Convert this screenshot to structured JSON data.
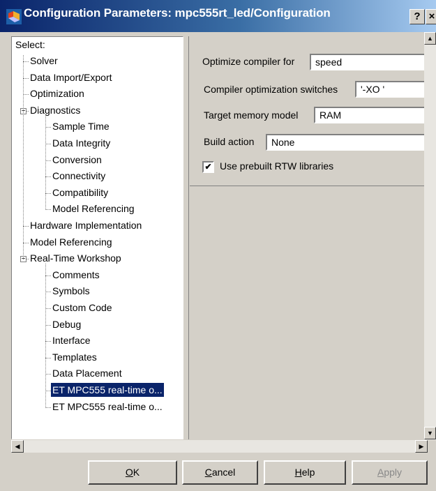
{
  "window": {
    "title": "Configuration Parameters: mpc555rt_led/Configuration",
    "help_button": "?",
    "close_button": "×"
  },
  "tree": {
    "header": "Select:",
    "items": [
      {
        "label": "Solver",
        "level": 0
      },
      {
        "label": "Data Import/Export",
        "level": 0
      },
      {
        "label": "Optimization",
        "level": 0
      },
      {
        "label": "Diagnostics",
        "level": 0,
        "expanded": true
      },
      {
        "label": "Sample Time",
        "level": 1
      },
      {
        "label": "Data Integrity",
        "level": 1
      },
      {
        "label": "Conversion",
        "level": 1
      },
      {
        "label": "Connectivity",
        "level": 1
      },
      {
        "label": "Compatibility",
        "level": 1
      },
      {
        "label": "Model Referencing",
        "level": 1
      },
      {
        "label": "Hardware Implementation",
        "level": 0
      },
      {
        "label": "Model Referencing",
        "level": 0
      },
      {
        "label": "Real-Time Workshop",
        "level": 0,
        "expanded": true
      },
      {
        "label": "Comments",
        "level": 1
      },
      {
        "label": "Symbols",
        "level": 1
      },
      {
        "label": "Custom Code",
        "level": 1
      },
      {
        "label": "Debug",
        "level": 1
      },
      {
        "label": "Interface",
        "level": 1
      },
      {
        "label": "Templates",
        "level": 1
      },
      {
        "label": "Data Placement",
        "level": 1
      },
      {
        "label": "ET MPC555 real-time o...",
        "level": 1,
        "selected": true
      },
      {
        "label": "ET MPC555 real-time o...",
        "level": 1
      }
    ]
  },
  "settings": {
    "optimize_label": "Optimize compiler for",
    "optimize_value": "speed",
    "switches_label": "Compiler optimization switches",
    "switches_value": "'-XO '",
    "memory_label": "Target memory model",
    "memory_value": "RAM",
    "build_label": "Build action",
    "build_value": "None",
    "prebuilt_label": "Use prebuilt RTW libraries",
    "prebuilt_checked": true
  },
  "buttons": {
    "ok": "OK",
    "cancel": "Cancel",
    "help": "Help",
    "apply": "Apply"
  },
  "colors": {
    "title_bar": "#0a246a",
    "selection": "#0a246a",
    "dialog_bg": "#d4d0c8"
  }
}
